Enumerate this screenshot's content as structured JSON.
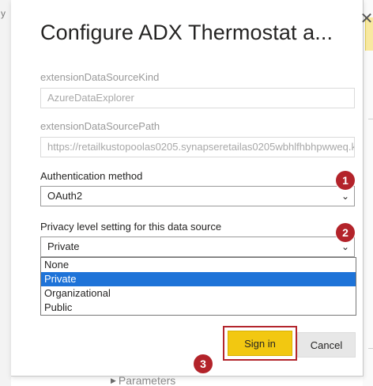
{
  "background": {
    "left_glyph": "y",
    "bottom_link": "Parameters",
    "bottom_icon": "triangle-right-icon"
  },
  "dialog": {
    "title": "Configure ADX Thermostat a...",
    "close_icon": "close-icon",
    "fields": {
      "kind_label": "extensionDataSourceKind",
      "kind_value": "AzureDataExplorer",
      "path_label": "extensionDataSourcePath",
      "path_value": "https://retailkustopoolas0205.synapseretailas0205wbhlfhbhpwweq.k"
    },
    "auth": {
      "label": "Authentication method",
      "value": "OAuth2"
    },
    "privacy": {
      "label": "Privacy level setting for this data source",
      "value": "Private",
      "options": [
        "None",
        "Private",
        "Organizational",
        "Public"
      ],
      "selected": "Private"
    },
    "buttons": {
      "signin": "Sign in",
      "cancel": "Cancel"
    }
  },
  "annotations": {
    "badges": [
      "1",
      "2",
      "3"
    ],
    "badge_color": "#b3232a"
  },
  "colors": {
    "accent_yellow": "#f2c811",
    "selection_blue": "#1e73d8",
    "highlight_red": "#b3262d"
  }
}
